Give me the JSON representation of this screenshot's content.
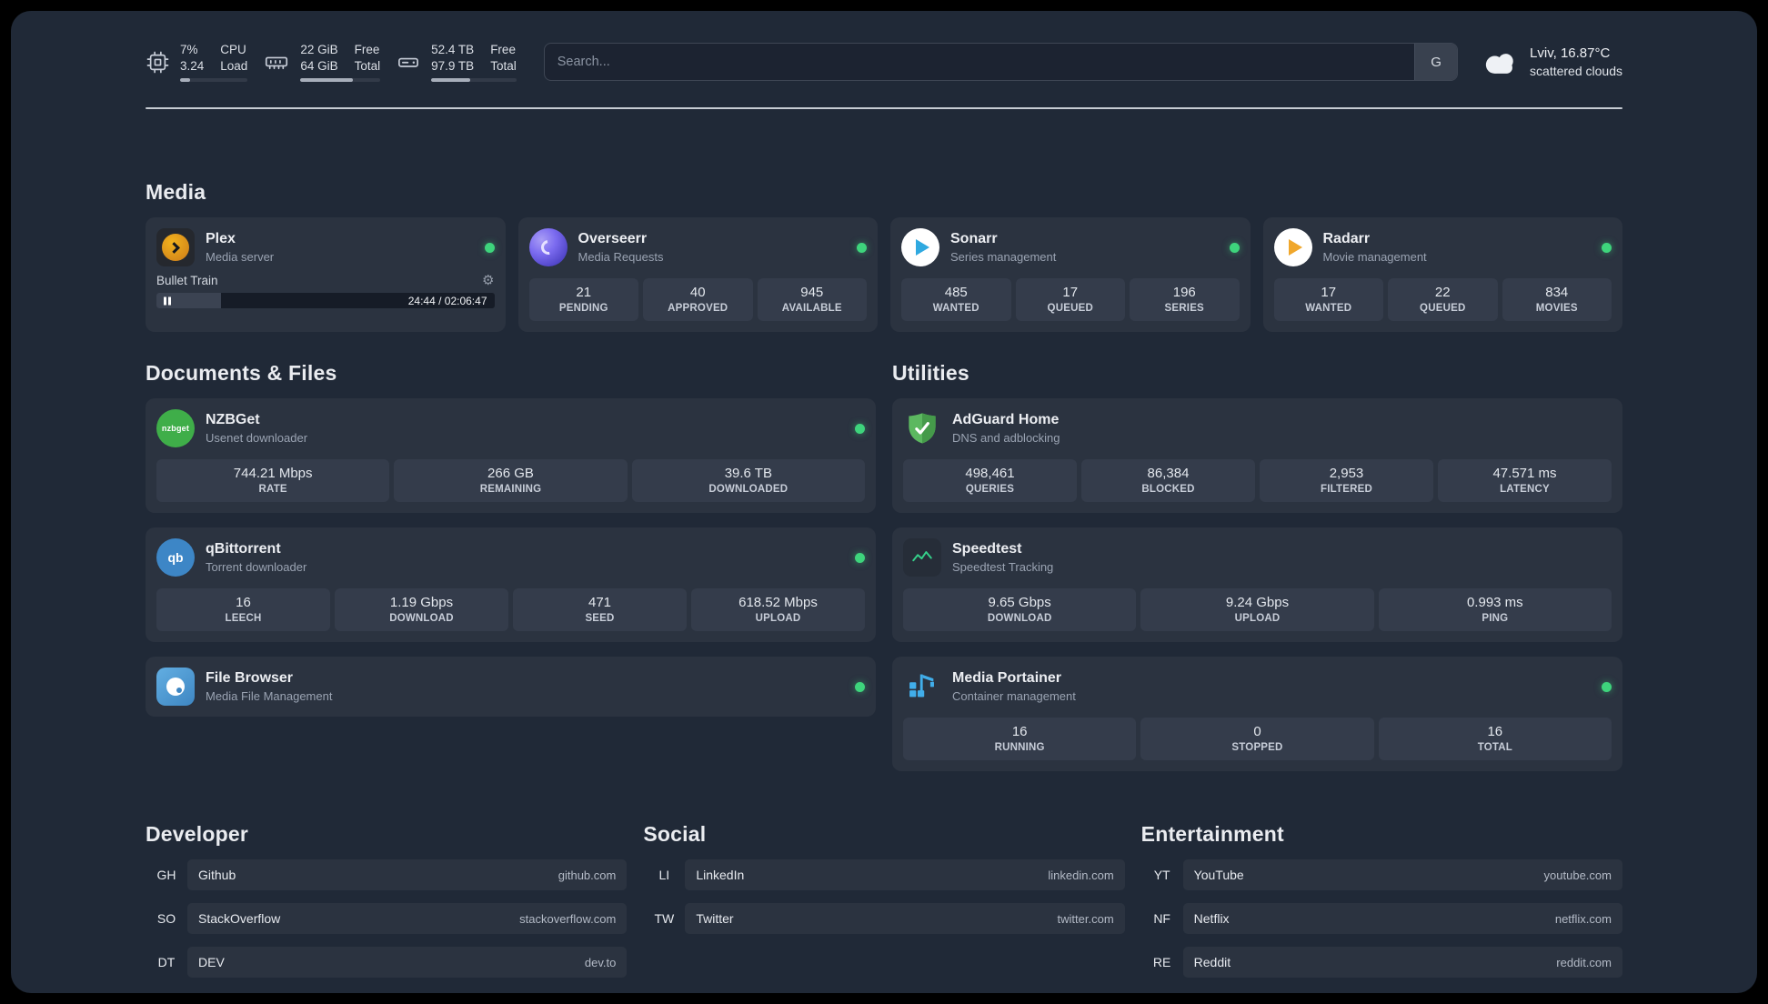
{
  "colors": {
    "page_bg": "#202937",
    "card_bg": "#2b3340",
    "tile_bg": "#343c4b",
    "status_online": "#3ed47c",
    "plex_amber": "#e5a00d",
    "overseerr_purple": "#7c6cf0",
    "sonarr_blue": "#2fa9e0",
    "radarr_amber": "#f0a72c",
    "nzbget_green": "#3fae49",
    "qbittorrent_blue": "#3d86c6",
    "filebrowser_blue": "#3e86c2",
    "adguard_green": "#5cb860",
    "speedtest_green": "#35d08a",
    "portainer_blue": "#41aeea"
  },
  "topbar": {
    "cpu": {
      "values": [
        "7%",
        "3.24"
      ],
      "labels": [
        "CPU",
        "Load"
      ],
      "progress_pct": 15
    },
    "memory": {
      "values": [
        "22 GiB",
        "64 GiB"
      ],
      "labels": [
        "Free",
        "Total"
      ],
      "progress_pct": 66
    },
    "disk": {
      "values": [
        "52.4 TB",
        "97.9 TB"
      ],
      "labels": [
        "Free",
        "Total"
      ],
      "progress_pct": 46
    },
    "search": {
      "placeholder": "Search...",
      "button_label": "G"
    },
    "weather": {
      "location": "Lviv, 16.87°C",
      "condition": "scattered clouds"
    }
  },
  "sections": {
    "media": {
      "title": "Media",
      "cards": [
        {
          "name": "Plex",
          "description": "Media server",
          "player": {
            "title": "Bullet Train",
            "time": "24:44 / 02:06:47",
            "progress_pct": 19
          }
        },
        {
          "name": "Overseerr",
          "description": "Media Requests",
          "stats": [
            {
              "value": "21",
              "label": "PENDING"
            },
            {
              "value": "40",
              "label": "APPROVED"
            },
            {
              "value": "945",
              "label": "AVAILABLE"
            }
          ]
        },
        {
          "name": "Sonarr",
          "description": "Series management",
          "stats": [
            {
              "value": "485",
              "label": "WANTED"
            },
            {
              "value": "17",
              "label": "QUEUED"
            },
            {
              "value": "196",
              "label": "SERIES"
            }
          ]
        },
        {
          "name": "Radarr",
          "description": "Movie management",
          "stats": [
            {
              "value": "17",
              "label": "WANTED"
            },
            {
              "value": "22",
              "label": "QUEUED"
            },
            {
              "value": "834",
              "label": "MOVIES"
            }
          ]
        }
      ]
    },
    "documents": {
      "title": "Documents & Files",
      "cards": [
        {
          "name": "NZBGet",
          "description": "Usenet downloader",
          "icon_text": "nzbget",
          "stats": [
            {
              "value": "744.21 Mbps",
              "label": "RATE"
            },
            {
              "value": "266 GB",
              "label": "REMAINING"
            },
            {
              "value": "39.6 TB",
              "label": "DOWNLOADED"
            }
          ]
        },
        {
          "name": "qBittorrent",
          "description": "Torrent downloader",
          "icon_text": "qb",
          "stats": [
            {
              "value": "16",
              "label": "LEECH"
            },
            {
              "value": "1.19 Gbps",
              "label": "DOWNLOAD"
            },
            {
              "value": "471",
              "label": "SEED"
            },
            {
              "value": "618.52 Mbps",
              "label": "UPLOAD"
            }
          ]
        },
        {
          "name": "File Browser",
          "description": "Media File Management"
        }
      ]
    },
    "utilities": {
      "title": "Utilities",
      "cards": [
        {
          "name": "AdGuard Home",
          "description": "DNS and adblocking",
          "stats": [
            {
              "value": "498,461",
              "label": "QUERIES"
            },
            {
              "value": "86,384",
              "label": "BLOCKED"
            },
            {
              "value": "2,953",
              "label": "FILTERED"
            },
            {
              "value": "47.571 ms",
              "label": "LATENCY"
            }
          ]
        },
        {
          "name": "Speedtest",
          "description": "Speedtest Tracking",
          "stats": [
            {
              "value": "9.65 Gbps",
              "label": "DOWNLOAD"
            },
            {
              "value": "9.24 Gbps",
              "label": "UPLOAD"
            },
            {
              "value": "0.993 ms",
              "label": "PING"
            }
          ]
        },
        {
          "name": "Media Portainer",
          "description": "Container management",
          "stats": [
            {
              "value": "16",
              "label": "RUNNING"
            },
            {
              "value": "0",
              "label": "STOPPED"
            },
            {
              "value": "16",
              "label": "TOTAL"
            }
          ]
        }
      ]
    }
  },
  "bookmarks": [
    {
      "title": "Developer",
      "items": [
        {
          "abbr": "GH",
          "name": "Github",
          "url": "github.com"
        },
        {
          "abbr": "SO",
          "name": "StackOverflow",
          "url": "stackoverflow.com"
        },
        {
          "abbr": "DT",
          "name": "DEV",
          "url": "dev.to"
        }
      ]
    },
    {
      "title": "Social",
      "items": [
        {
          "abbr": "LI",
          "name": "LinkedIn",
          "url": "linkedin.com"
        },
        {
          "abbr": "TW",
          "name": "Twitter",
          "url": "twitter.com"
        }
      ]
    },
    {
      "title": "Entertainment",
      "items": [
        {
          "abbr": "YT",
          "name": "YouTube",
          "url": "youtube.com"
        },
        {
          "abbr": "NF",
          "name": "Netflix",
          "url": "netflix.com"
        },
        {
          "abbr": "RE",
          "name": "Reddit",
          "url": "reddit.com"
        }
      ]
    }
  ]
}
